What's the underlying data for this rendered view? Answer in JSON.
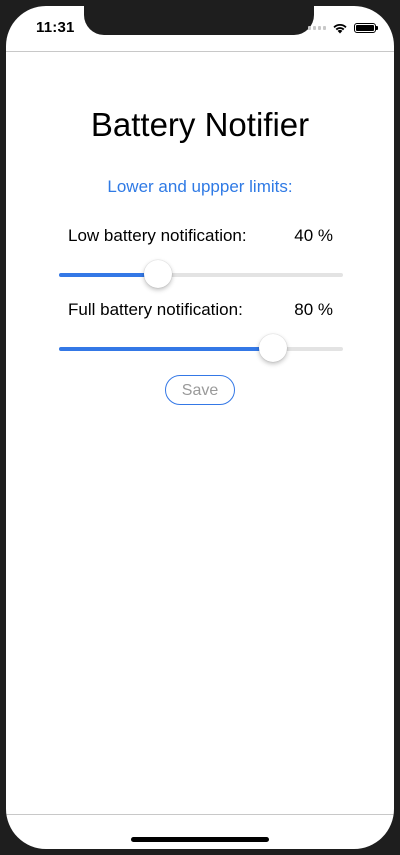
{
  "status_bar": {
    "time": "11:31",
    "icons": [
      "signal-icon",
      "wifi-icon",
      "battery-icon"
    ]
  },
  "app": {
    "title": "Battery Notifier",
    "subtitle": "Lower and uppper limits:"
  },
  "low_battery": {
    "label": "Low battery notification:",
    "value_text": "40 %",
    "slider_fraction": 0.35
  },
  "full_battery": {
    "label": "Full battery notification:",
    "value_text": "80 %",
    "slider_fraction": 0.755
  },
  "save_button": {
    "label": "Save"
  },
  "colors": {
    "accent": "#3478e6",
    "subtitle": "#2f7ae5",
    "track": "#e3e3e3",
    "disabled_text": "#9a9a9a"
  }
}
